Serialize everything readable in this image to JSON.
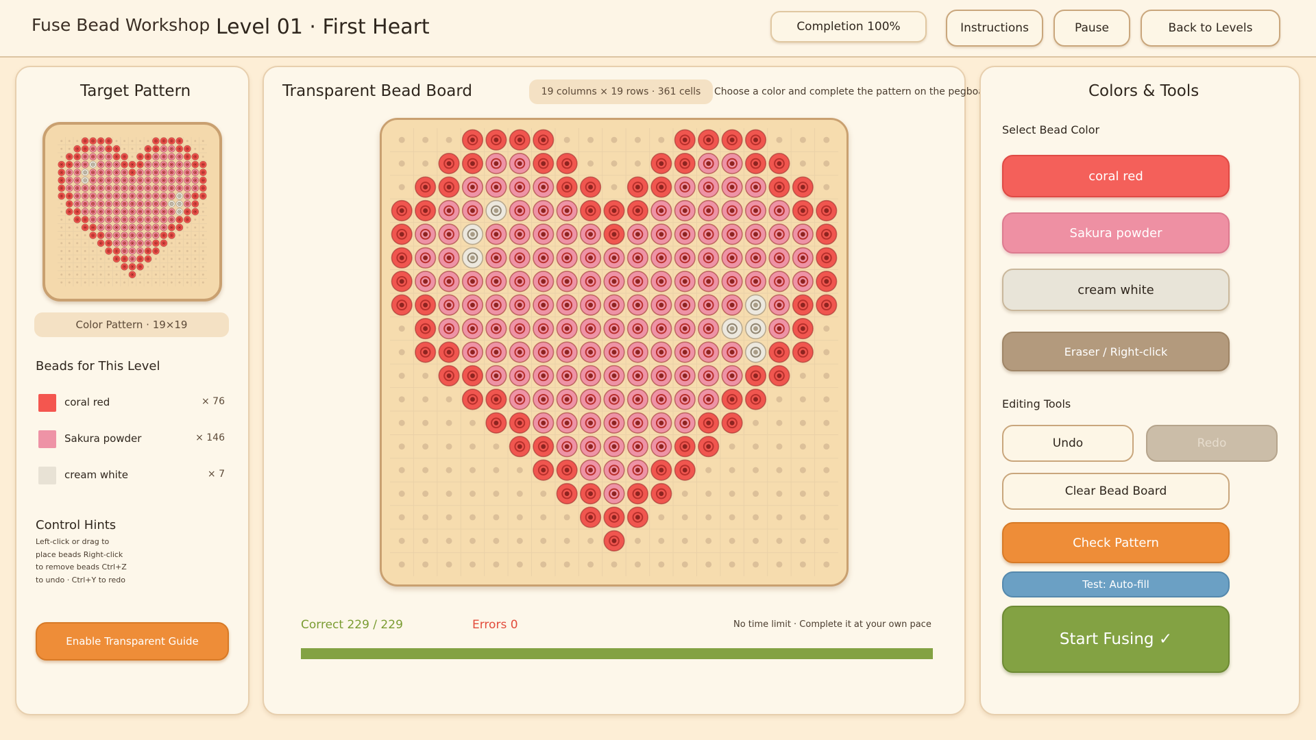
{
  "header": {
    "app_title": "Fuse Bead Workshop",
    "level_title": "Level 01 · First Heart",
    "completion": "Completion 100%",
    "instructions_label": "Instructions",
    "pause_label": "Pause",
    "back_label": "Back to Levels"
  },
  "left": {
    "title": "Target Pattern",
    "pattern_label": "Color Pattern · 19×19",
    "beads_title": "Beads for This Level",
    "legend": [
      {
        "name": "coral red",
        "count": "× 76",
        "color": "#f4564f"
      },
      {
        "name": "Sakura powder",
        "count": "× 146",
        "color": "#ee93a6"
      },
      {
        "name": "cream white",
        "count": "× 7",
        "color": "#e8e2d5"
      }
    ],
    "hints_title": "Control Hints",
    "hints_text": "Left-click or drag to place beads Right-click to remove beads Ctrl+Z to undo · Ctrl+Y to redo",
    "guide_button": "Enable Transparent Guide"
  },
  "board": {
    "title": "Transparent Bead Board",
    "info": "19 columns × 19 rows · 361 cells",
    "message": "Choose a color and complete the pattern on the pegboard",
    "correct": "Correct 229 / 229",
    "errors": "Errors 0",
    "time_note": "No time limit · Complete it at your own pace",
    "progress": 1.0
  },
  "right": {
    "title": "Colors & Tools",
    "select_label": "Select Bead Color",
    "colors": [
      {
        "label": "coral red",
        "color": "#f4605a"
      },
      {
        "label": "Sakura powder",
        "color": "#ee90a3"
      },
      {
        "label": "cream white",
        "color": "#e8e4d8"
      },
      {
        "label": "Eraser / Right-click",
        "color": "#b39a7d"
      }
    ],
    "tools_label": "Editing Tools",
    "undo": "Undo",
    "redo": "Redo",
    "clear": "Clear Bead Board",
    "check": "Check Pattern",
    "autofill": "Test: Auto-fill",
    "start": "Start Fusing ✓"
  },
  "pattern": {
    "cols": 19,
    "rows": 19,
    "legend": {
      ".": "empty",
      "R": "coral red",
      "P": "Sakura powder",
      "W": "cream white"
    },
    "grid": [
      "...RRRR.....RRRR...",
      "..RRPPRR...RRPPRR..",
      ".RRPPPPRR.RRPPPPRR.",
      "RRPPWPPPRRRPPPPPPRR",
      "RPPWPPPPPRPPPPPPPPR",
      "RPPWPPPPPPPPPPPPPPR",
      "RPPPPPPPPPPPPPPPPPR",
      "RRPPPPPPPPPPPPPWPRR",
      ".RPPPPPPPPPPPPWWPR.",
      ".RRPPPPPPPPPPPPWRR.",
      "..RRPPPPPPPPPPPRR..",
      "...RRPPPPPPPPPRR...",
      "....RRPPPPPPPRR....",
      ".....RRPPPPPRR.....",
      "......RRPPPRR......",
      ".......RRPRR.......",
      "........RRR........",
      ".........R.........",
      "..................."
    ],
    "bead_colors": {
      "R": "#f0564f",
      "P": "#ee93a6",
      "W": "#ece8de"
    }
  }
}
